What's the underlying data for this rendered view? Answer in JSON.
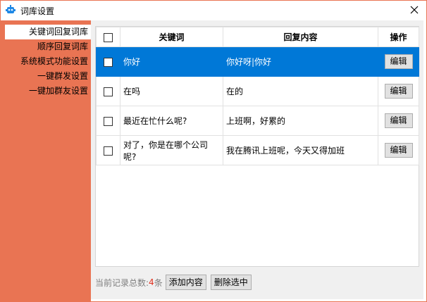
{
  "window": {
    "title": "词库设置",
    "close_glyph": "✕",
    "accent_color": "#e97453",
    "selected_row_color": "#0078d7"
  },
  "sidebar": {
    "items": [
      {
        "label": "关键词回复词库",
        "active": true
      },
      {
        "label": "顺序回复词库",
        "active": false
      },
      {
        "label": "系统模式功能设置",
        "active": false
      },
      {
        "label": "一键群发设置",
        "active": false
      },
      {
        "label": "一键加群友设置",
        "active": false
      }
    ]
  },
  "table": {
    "headers": {
      "keyword": "关键词",
      "reply": "回复内容",
      "action": "操作"
    },
    "rows": [
      {
        "keyword": "你好",
        "reply": "你好呀|你好",
        "action": "编辑",
        "selected": true
      },
      {
        "keyword": "在吗",
        "reply": "在的",
        "action": "编辑",
        "selected": false
      },
      {
        "keyword": "最近在忙什么呢?",
        "reply": "上班啊，好累的",
        "action": "编辑",
        "selected": false
      },
      {
        "keyword": "对了，你是在哪个公司呢?",
        "reply": "我在腾讯上班呢，今天又得加班",
        "action": "编辑",
        "selected": false
      }
    ]
  },
  "footer": {
    "count_label": "当前记录总数:",
    "count_value": "4",
    "count_unit": "条",
    "add_button": "添加内容",
    "delete_button": "删除选中"
  }
}
